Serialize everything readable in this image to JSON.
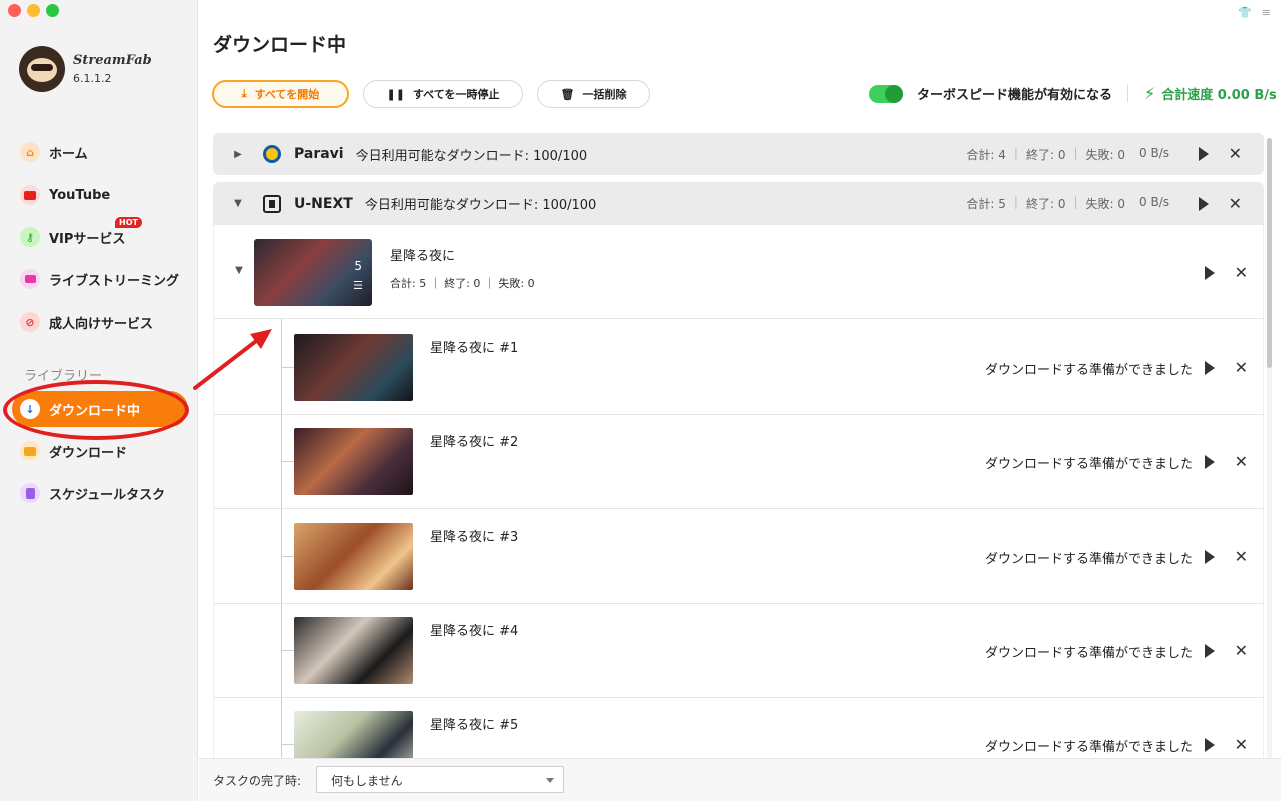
{
  "app": {
    "name": "StreamFab",
    "version": "6.1.1.2"
  },
  "sidebar": {
    "items": [
      {
        "label": "ホーム",
        "icon": "home-icon"
      },
      {
        "label": "YouTube",
        "icon": "youtube-icon"
      },
      {
        "label": "VIPサービス",
        "icon": "key-icon",
        "badge": "HOT"
      },
      {
        "label": "ライブストリーミング",
        "icon": "camera-icon"
      },
      {
        "label": "成人向けサービス",
        "icon": "adult-icon"
      }
    ],
    "library_label": "ライブラリー",
    "library": [
      {
        "label": "ダウンロード中",
        "icon": "download-icon",
        "active": true
      },
      {
        "label": "ダウンロード",
        "icon": "folder-icon"
      },
      {
        "label": "スケジュールタスク",
        "icon": "schedule-icon"
      }
    ]
  },
  "page": {
    "title": "ダウンロード中"
  },
  "toolbar": {
    "start_all": "すべてを開始",
    "pause_all": "すべてを一時停止",
    "delete_all": "一括削除",
    "turbo_label": "ターボスピード機能が有効になる",
    "turbo_on": true,
    "speed_label": "合計速度 0.00 B/s"
  },
  "groups": [
    {
      "service": "Paravi",
      "quota": "今日利用可能なダウンロード: 100/100",
      "total": "合計: 4",
      "done": "終了: 0",
      "failed": "失敗: 0",
      "speed": "0 B/s",
      "expanded": false
    },
    {
      "service": "U-NEXT",
      "quota": "今日利用可能なダウンロード: 100/100",
      "total": "合計: 5",
      "done": "終了: 0",
      "failed": "失敗: 0",
      "speed": "0 B/s",
      "expanded": true
    }
  ],
  "series": {
    "title": "星降る夜に",
    "count": "5",
    "stats": "合計: 5 ｜ 終了: 0 ｜ 失敗: 0"
  },
  "episodes": [
    {
      "title": "星降る夜に #1",
      "status": "ダウンロードする準備ができました"
    },
    {
      "title": "星降る夜に #2",
      "status": "ダウンロードする準備ができました"
    },
    {
      "title": "星降る夜に #3",
      "status": "ダウンロードする準備ができました"
    },
    {
      "title": "星降る夜に #4",
      "status": "ダウンロードする準備ができました"
    },
    {
      "title": "星降る夜に #5",
      "status": "ダウンロードする準備ができました"
    }
  ],
  "footer": {
    "label": "タスクの完了時:",
    "selected": "何もしません"
  },
  "colors": {
    "accent": "#f97d0b",
    "speed_green": "#2ca14a",
    "annotation_red": "#e02020"
  }
}
